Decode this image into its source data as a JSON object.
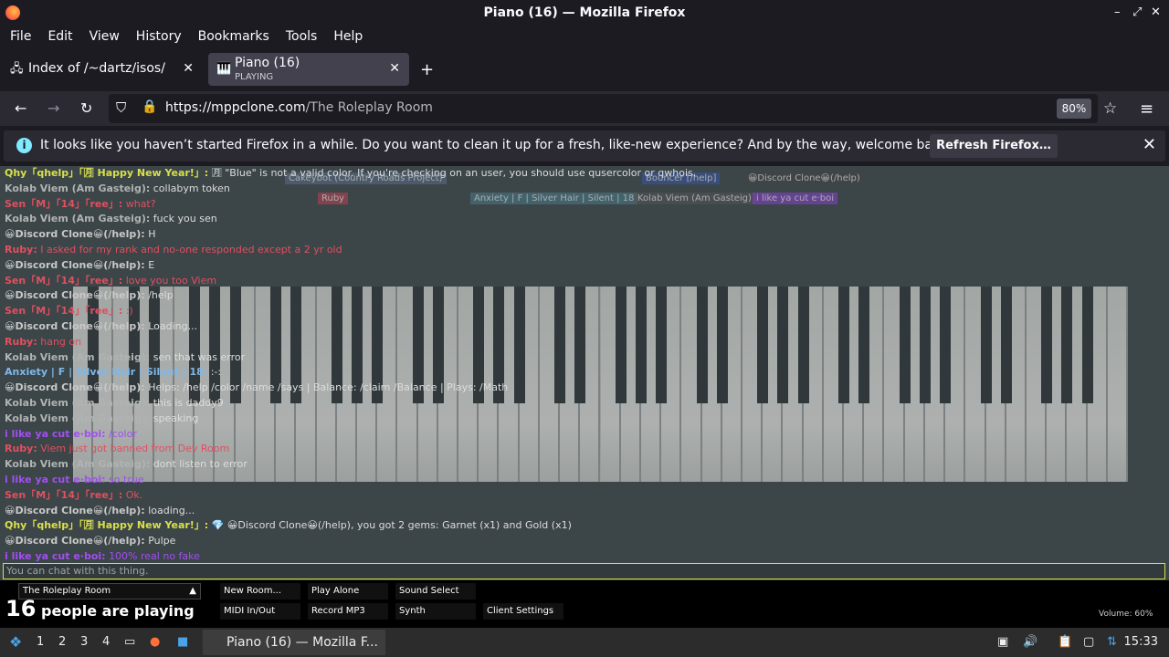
{
  "window": {
    "title": "Piano (16) — Mozilla Firefox"
  },
  "menu": [
    "File",
    "Edit",
    "View",
    "History",
    "Bookmarks",
    "Tools",
    "Help"
  ],
  "tabs": [
    {
      "label": "Index of /~dartz/isos/"
    },
    {
      "label": "Piano (16)",
      "status": "PLAYING"
    }
  ],
  "nav": {
    "url_host": "https://mppclone.com",
    "url_path": "/The Roleplay Room",
    "zoom": "80%"
  },
  "notification": {
    "message": "It looks like you haven’t started Firefox in a while. Do you want to clean it up for a fresh, like-new experience? And by the way, welcome back!",
    "button": "Refresh Firefox…"
  },
  "chat": [
    {
      "who": "Qhy「qhelp」「🈷 Happy New Year!」:",
      "msg": "🈷 \"Blue\" is not a valid color. If you're checking on an user, you should use qusercolor or qwhois.",
      "color": "#d8e04a"
    },
    {
      "who": "Kolab Viem (Am Gasteig):",
      "msg": "collabym token",
      "color": "#b0b3b2"
    },
    {
      "who": "Sen「M」「14」「ree」:",
      "msg": "what?",
      "color": "#e05060"
    },
    {
      "who": "Kolab Viem (Am Gasteig):",
      "msg": "fuck you sen",
      "color": "#b0b3b2"
    },
    {
      "who": "😀Discord Clone😀(/help):",
      "msg": "H",
      "color": "#c8c8c8"
    },
    {
      "who": "Ruby:",
      "msg": "I asked for my rank and no-one responded except a 2 yr old",
      "color": "#e05060"
    },
    {
      "who": "😀Discord Clone😀(/help):",
      "msg": "E",
      "color": "#c8c8c8"
    },
    {
      "who": "Sen「M」「14」「ree」:",
      "msg": "love you too Viem",
      "color": "#e05060"
    },
    {
      "who": "😀Discord Clone😀(/help):",
      "msg": "/help",
      "color": "#c8c8c8"
    },
    {
      "who": "Sen「M」「14」「ree」:",
      "msg": ":)",
      "color": "#e05060"
    },
    {
      "who": "😀Discord Clone😀(/help):",
      "msg": "Loading...",
      "color": "#c8c8c8"
    },
    {
      "who": "Ruby:",
      "msg": "hang on",
      "color": "#e05060"
    },
    {
      "who": "Kolab Viem (Am Gasteig):",
      "msg": "sen that was error",
      "color": "#b0b3b2"
    },
    {
      "who": "Anxiety | F | Silver Hair | Silent | 18:",
      "msg": ":-:",
      "color": "#7fb8e8"
    },
    {
      "who": "😀Discord Clone😀(/help):",
      "msg": "Helps: /help /color /name /says | Balance: /claim /Balance | Plays: /Math",
      "color": "#c8c8c8"
    },
    {
      "who": "Kolab Viem (Am Gasteig):",
      "msg": "this is daddy9",
      "color": "#b0b3b2"
    },
    {
      "who": "Kolab Viem (Am Gasteig):",
      "msg": "speaking",
      "color": "#b0b3b2"
    },
    {
      "who": "i like ya cut e·boi:",
      "msg": "/color",
      "color": "#a050f0"
    },
    {
      "who": "Ruby:",
      "msg": "Viem just got banned from Dev Room",
      "color": "#e05060"
    },
    {
      "who": "Kolab Viem (Am Gasteig):",
      "msg": "dont listen to error",
      "color": "#b0b3b2"
    },
    {
      "who": "i like ya cut e·boi:",
      "msg": "so true",
      "color": "#a050f0"
    },
    {
      "who": "Sen「M」「14」「ree」:",
      "msg": "Ok.",
      "color": "#e05060"
    },
    {
      "who": "😀Discord Clone😀(/help):",
      "msg": "loading...",
      "color": "#c8c8c8"
    },
    {
      "who": "Qhy「qhelp」「🈷 Happy New Year!」:",
      "msg": "💎 😀Discord Clone😀(/help), you got 2 gems: Garnet (x1) and Gold (x1)",
      "color": "#d8e04a"
    },
    {
      "who": "😀Discord Clone😀(/help):",
      "msg": "Pulpe",
      "color": "#c8c8c8"
    },
    {
      "who": "i like ya cut e·boi:",
      "msg": "100% real no fake",
      "color": "#a050f0"
    }
  ],
  "user_tags": [
    {
      "label": "Cakeybot (Country Roads Project)",
      "color": "#5a6c8a"
    },
    {
      "label": "Bouncer [/help]",
      "color": "#3a57a8"
    },
    {
      "label": "😀Discord Clone😀(/help)",
      "color": "#444"
    },
    {
      "label": "Ruby",
      "color": "#c04050"
    },
    {
      "label": "Anxiety | F | Silver Hair | Silent | 18",
      "color": "#4a7c8a"
    },
    {
      "label": "Kolab Viem (Am Gasteig)",
      "color": "#555"
    },
    {
      "label": "i like ya cut e·boi",
      "color": "#8a40d0"
    }
  ],
  "input": {
    "placeholder": "You can chat with this thing."
  },
  "room": {
    "name": "The Roleplay Room",
    "buttons": [
      "New Room...",
      "Play Alone",
      "Sound Select",
      "MIDI In/Out",
      "Record MP3",
      "Synth",
      "Client Settings"
    ],
    "count": "16",
    "count_text": "people are playing",
    "volume": "Volume: 60%"
  },
  "taskbar": {
    "workspaces": [
      "1",
      "2",
      "3",
      "4"
    ],
    "task": "Piano (16) — Mozilla F...",
    "clock": "15:33"
  }
}
